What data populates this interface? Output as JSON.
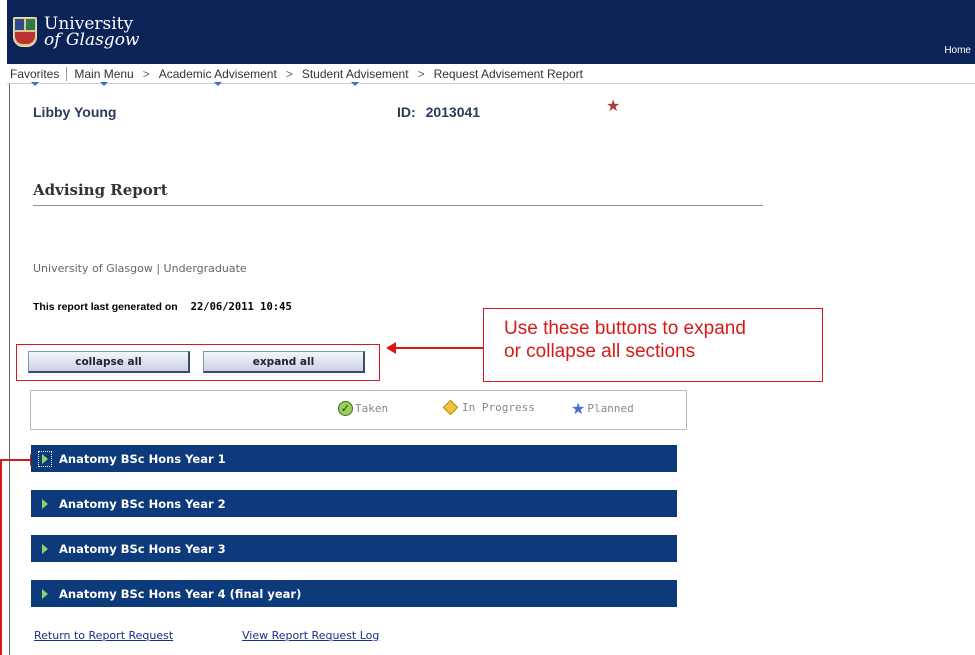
{
  "header": {
    "logo": {
      "line1": "University",
      "line2": "of Glasgow",
      "icon": "university-crest-icon"
    },
    "home_label": "Home"
  },
  "nav": {
    "items": [
      {
        "label": "Favorites"
      },
      {
        "label": "Main Menu"
      },
      {
        "label": "Academic Advisement"
      },
      {
        "label": "Student Advisement"
      },
      {
        "label": "Request Advisement Report"
      }
    ]
  },
  "student": {
    "name": "Libby Young",
    "id_label": "ID:",
    "id_value": "2013041",
    "star_icon": "star-icon"
  },
  "report": {
    "title": "Advising Report",
    "institution": "University of Glasgow | Undergraduate",
    "generated_label": "This report last generated on",
    "generated_value": "22/06/2011 10:45"
  },
  "buttons": {
    "collapse_label": "collapse all",
    "expand_label": "expand all"
  },
  "callout": {
    "line1": "Use these buttons to expand",
    "line2": "or collapse all sections"
  },
  "legend": {
    "taken": "Taken",
    "in_progress": "In Progress",
    "planned": "Planned"
  },
  "sections": [
    {
      "label": "Anatomy BSc Hons Year 1"
    },
    {
      "label": "Anatomy BSc Hons Year 2"
    },
    {
      "label": "Anatomy BSc Hons Year 3"
    },
    {
      "label": "Anatomy BSc Hons Year 4 (final year)"
    }
  ],
  "footer": {
    "return_link": "Return to Report Request",
    "log_link": "View Report Request Log"
  },
  "colors": {
    "header_bg": "#0c2357",
    "section_bg": "#0d3a7a",
    "annotation_red": "#d61a1a"
  }
}
